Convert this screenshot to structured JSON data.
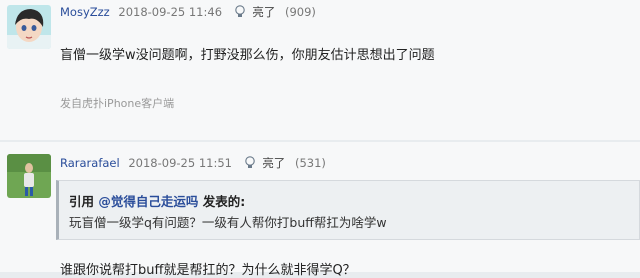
{
  "posts": [
    {
      "username": "MosyZzz",
      "date": "2018-09-25 11:46",
      "reply_label": "亮了",
      "reply_count": "(909)",
      "content": "盲僧一级学w没问题啊，打野没那么伤，你朋友估计思想出了问题",
      "source": "发自虎扑iPhone客户端"
    },
    {
      "username": "Rararafael",
      "date": "2018-09-25 11:51",
      "reply_label": "亮了",
      "reply_count": "(531)",
      "quote": {
        "prefix": "引用 ",
        "author": "@觉得自己走运吗",
        "suffix": " 发表的:",
        "text": "玩盲僧一级学q有问题？一级有人帮你打buff帮扛为啥学w"
      },
      "content": "谁跟你说帮打buff就是帮扛的？为什么就非得学Q？"
    }
  ],
  "icons": {
    "thumb": "light-bulb-icon"
  }
}
